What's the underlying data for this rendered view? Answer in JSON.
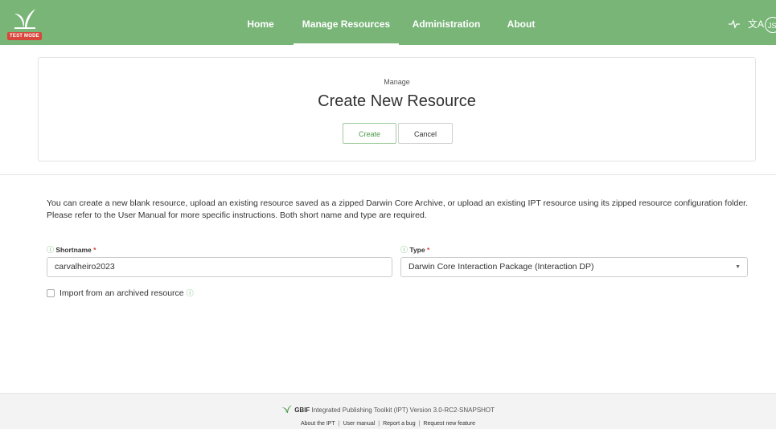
{
  "navbar": {
    "test_badge": "TEST MODE",
    "items": [
      "Home",
      "Manage Resources",
      "Administration",
      "About"
    ],
    "active": "Manage Resources",
    "avatar": "JS",
    "bg_color": "#78b577"
  },
  "header": {
    "subtitle": "Manage",
    "title": "Create New Resource",
    "create_label": "Create",
    "cancel_label": "Cancel"
  },
  "form": {
    "intro": "You can create a new blank resource, upload an existing resource saved as a zipped Darwin Core Archive, or upload an existing IPT resource using its zipped resource configuration folder. Please refer to the User Manual for more specific instructions. Both short name and type are required.",
    "shortname_label": "Shortname",
    "shortname_value": "carvalheiro2023",
    "type_label": "Type",
    "type_value": "Darwin Core Interaction Package (Interaction DP)",
    "required_mark": "*",
    "import_label": "Import from an archived resource"
  },
  "footer": {
    "brand": "GBIF",
    "text": "Integrated Publishing Toolkit (IPT) Version 3.0-RC2-SNAPSHOT",
    "links": [
      "About the IPT",
      "User manual",
      "Report a bug",
      "Request new feature"
    ]
  }
}
